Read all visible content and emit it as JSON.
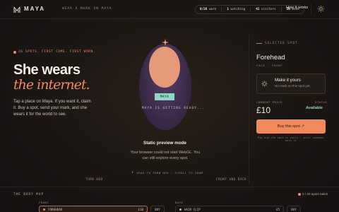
{
  "header": {
    "brand": "MAYA",
    "tagline": "WEAR A MARK ON MAYA",
    "stats": [
      {
        "value": "0/26",
        "label": "worn"
      },
      {
        "value": "1",
        "label": "watching"
      },
      {
        "value": "41",
        "label": "visitors"
      },
      {
        "value": "20",
        "label": "mode"
      }
    ],
    "how_label": "How it works"
  },
  "hero": {
    "eyebrow": "26 SPOTS. FIRST COME. FIRST WORN.",
    "title_line1": "She wears",
    "title_line2": "the internet.",
    "lead": "Tap a place on Maya. If you want it, claim it. Buy a spot, send your mark, and she wears it for the world to see."
  },
  "stage": {
    "figure_tag": "MAYA",
    "loading": "MAYA IS GETTING READY...",
    "preview_title": "Static preview mode",
    "preview_sub": "Your browser could not start WebGL. You can still explore every spot.",
    "drag_hint": "DRAG TO TURN HER · SCROLL TO ZOOM",
    "turn_left": "TURN HER",
    "turn_right": "FRONT AND BACK"
  },
  "panel": {
    "label": "SELECTED SPOT",
    "title": "Forehead",
    "meta": "FACE · FRONT",
    "card_title": "Make it yours",
    "card_sub": "No mark on this spot yet.",
    "price_label": "CURRENT PRICE",
    "price": "£10",
    "status_label": "STATUS",
    "status": "Available",
    "buy_label": "Buy this spot ↗",
    "fine": "Pay and the spot is yours · until someone buys it"
  },
  "body_map": {
    "label": "THE BODY MAP",
    "count": "0 / 26 spots taken",
    "front_label": "FRONT",
    "back_label": "BACK",
    "front_rows": [
      {
        "name": "FOREHEAD",
        "price": "£10",
        "buy": "BUY",
        "color": "#f08a5d"
      }
    ],
    "back_rows": [
      {
        "name": "HAIR CLIP",
        "price": "£5",
        "buy": "BUY",
        "color": "#8fd6c8"
      }
    ]
  }
}
